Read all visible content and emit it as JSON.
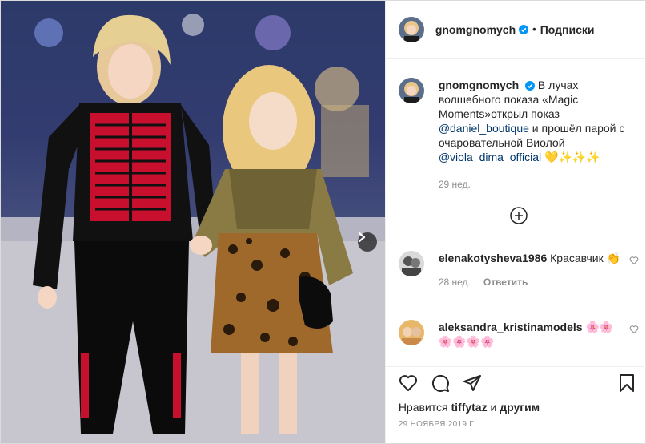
{
  "post": {
    "username": "gnomgnomych",
    "follow_label": "Подписки",
    "separator": "•"
  },
  "caption": {
    "username": "gnomgnomych",
    "text_1": " В лучах волшебного показа «Magic Moments»открыл показ ",
    "mention_1": "@daniel_boutique",
    "text_2": " и прошёл парой с очаровательной Виолой ",
    "mention_2": "@viola_dima_official",
    "emoji": " 💛✨✨✨",
    "time": "29 нед."
  },
  "comments": [
    {
      "username": "elenakotysheva1986",
      "text": " Красавчик 👏",
      "time": "28 нед.",
      "reply_label": "Ответить"
    },
    {
      "username": "aleksandra_kristinamodels",
      "text": " 🌸🌸 🌸🌸🌸🌸"
    }
  ],
  "likes": {
    "prefix": "Нравится ",
    "user": "tiffytaz",
    "middle": " и ",
    "others": "другим"
  },
  "date": "29 НОЯБРЯ 2019 Г.",
  "colors": {
    "verified": "#0095f6",
    "mention": "#00376b",
    "muted": "#8e8e8e"
  }
}
